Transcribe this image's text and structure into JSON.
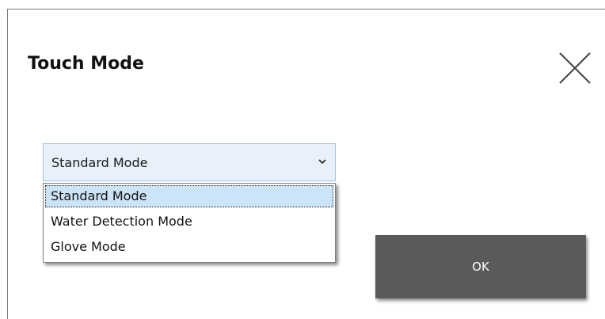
{
  "dialog": {
    "title": "Touch Mode",
    "close_icon": "close-icon"
  },
  "mode_select": {
    "selected_value": "Standard Mode",
    "chevron_icon": "chevron-down-icon",
    "options": [
      {
        "label": "Standard Mode",
        "highlighted": true
      },
      {
        "label": "Water Detection Mode",
        "highlighted": false
      },
      {
        "label": "Glove Mode",
        "highlighted": false
      }
    ]
  },
  "footer": {
    "ok_label": "OK"
  },
  "colors": {
    "ok_button": "#5a5a5a",
    "select_background": "#e8f1fa",
    "select_border": "#9cc3e6",
    "option_highlight": "#cce4f7"
  }
}
